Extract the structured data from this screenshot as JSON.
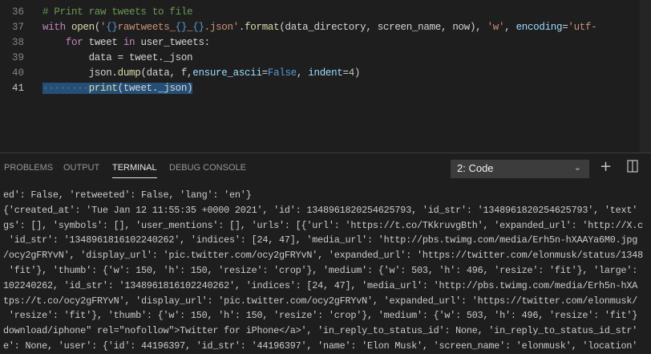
{
  "editor": {
    "lines": [
      {
        "num": "36",
        "parts": [
          {
            "t": "# Print raw tweets to file",
            "c": "cm"
          }
        ]
      },
      {
        "num": "37",
        "parts": [
          {
            "t": "with ",
            "c": "kw"
          },
          {
            "t": "open",
            "c": "fn"
          },
          {
            "t": "(",
            "c": ""
          },
          {
            "t": "'",
            "c": "st"
          },
          {
            "t": "{}",
            "c": "bl"
          },
          {
            "t": "rawtweets_",
            "c": "st"
          },
          {
            "t": "{}",
            "c": "bl"
          },
          {
            "t": "_",
            "c": "st"
          },
          {
            "t": "{}",
            "c": "bl"
          },
          {
            "t": ".json'",
            "c": "st"
          },
          {
            "t": ".",
            "c": ""
          },
          {
            "t": "format",
            "c": "fn"
          },
          {
            "t": "(data_directory, screen_name, now), ",
            "c": ""
          },
          {
            "t": "'w'",
            "c": "st"
          },
          {
            "t": ", ",
            "c": ""
          },
          {
            "t": "encoding",
            "c": "pa"
          },
          {
            "t": "=",
            "c": ""
          },
          {
            "t": "'utf-",
            "c": "st"
          }
        ]
      },
      {
        "num": "38",
        "parts": [
          {
            "t": "    ",
            "c": ""
          },
          {
            "t": "for",
            "c": "kw"
          },
          {
            "t": " tweet ",
            "c": ""
          },
          {
            "t": "in",
            "c": "kw"
          },
          {
            "t": " user_tweets:",
            "c": ""
          }
        ]
      },
      {
        "num": "39",
        "parts": [
          {
            "t": "        data = tweet._json",
            "c": ""
          }
        ]
      },
      {
        "num": "40",
        "parts": [
          {
            "t": "        json.",
            "c": ""
          },
          {
            "t": "dump",
            "c": "fn"
          },
          {
            "t": "(data, f,",
            "c": ""
          },
          {
            "t": "ensure_ascii",
            "c": "pa"
          },
          {
            "t": "=",
            "c": ""
          },
          {
            "t": "False",
            "c": "bl"
          },
          {
            "t": ", ",
            "c": ""
          },
          {
            "t": "indent",
            "c": "pa"
          },
          {
            "t": "=",
            "c": ""
          },
          {
            "t": "4",
            "c": "nu"
          },
          {
            "t": ")",
            "c": ""
          }
        ]
      },
      {
        "num": "41",
        "parts": [
          {
            "t": "········",
            "c": "sel dots"
          },
          {
            "t": "print",
            "c": "sel fn"
          },
          {
            "t": "(tweet._json)",
            "c": "sel"
          }
        ]
      }
    ]
  },
  "panel": {
    "tabs": [
      "PROBLEMS",
      "OUTPUT",
      "TERMINAL",
      "DEBUG CONSOLE"
    ],
    "active_tab": "TERMINAL",
    "terminal_select": "2: Code",
    "terminal_lines": [
      "ed': False, 'retweeted': False, 'lang': 'en'}",
      "{'created_at': 'Tue Jan 12 11:55:35 +0000 2021', 'id': 1348961820254625793, 'id_str': '1348961820254625793', 'text'",
      "gs': [], 'symbols': [], 'user_mentions': [], 'urls': [{'url': 'https://t.co/TKkruvgBth', 'expanded_url': 'http://X.c",
      " 'id_str': '1348961816102240262', 'indices': [24, 47], 'media_url': 'http://pbs.twimg.com/media/Erh5n-hXAAYa6M0.jpg",
      "/ocy2gFRYvN', 'display_url': 'pic.twitter.com/ocy2gFRYvN', 'expanded_url': 'https://twitter.com/elonmusk/status/1348",
      " 'fit'}, 'thumb': {'w': 150, 'h': 150, 'resize': 'crop'}, 'medium': {'w': 503, 'h': 496, 'resize': 'fit'}, 'large':",
      "102240262, 'id_str': '1348961816102240262', 'indices': [24, 47], 'media_url': 'http://pbs.twimg.com/media/Erh5n-hXA",
      "tps://t.co/ocy2gFRYvN', 'display_url': 'pic.twitter.com/ocy2gFRYvN', 'expanded_url': 'https://twitter.com/elonmusk/",
      " 'resize': 'fit'}, 'thumb': {'w': 150, 'h': 150, 'resize': 'crop'}, 'medium': {'w': 503, 'h': 496, 'resize': 'fit'}",
      "download/iphone\" rel=\"nofollow\">Twitter for iPhone</a>', 'in_reply_to_status_id': None, 'in_reply_to_status_id_str'",
      "e': None, 'user': {'id': 44196397, 'id_str': '44196397', 'name': 'Elon Musk', 'screen_name': 'elonmusk', 'location'"
    ]
  },
  "icons": {
    "new_terminal": "plus-icon",
    "split": "split-icon",
    "dropdown": "chevron-down-icon"
  }
}
